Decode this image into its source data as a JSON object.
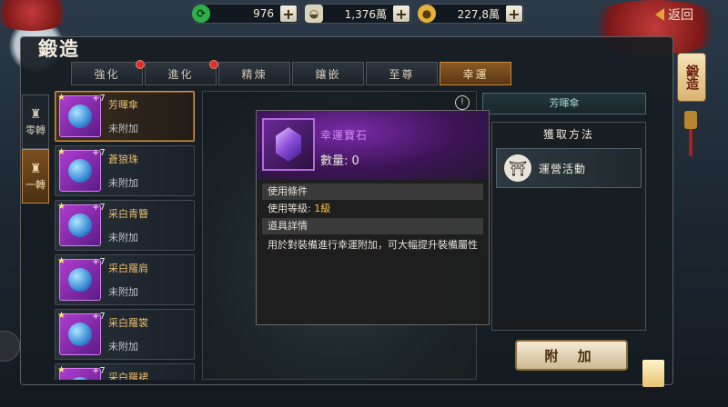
{
  "resources": [
    {
      "icon": "jade-token-icon",
      "value": "976",
      "color": "#2fae4a"
    },
    {
      "icon": "silver-ingot-icon",
      "value": "1,376萬",
      "color": "#d8d2b8"
    },
    {
      "icon": "gold-coin-icon",
      "value": "227,8萬",
      "color": "#e2b23a"
    }
  ],
  "back_label": "返回",
  "page_title": "鍛造",
  "tabs": [
    {
      "label": "強化",
      "badge": true,
      "active": false
    },
    {
      "label": "進化",
      "badge": true,
      "active": false
    },
    {
      "label": "精煉",
      "badge": false,
      "active": false
    },
    {
      "label": "鑲嵌",
      "badge": false,
      "active": false
    },
    {
      "label": "至尊",
      "badge": false,
      "active": false
    },
    {
      "label": "幸運",
      "badge": false,
      "active": true
    }
  ],
  "side_tabs": [
    {
      "label": "零轉",
      "active": false
    },
    {
      "label": "一轉",
      "active": true
    }
  ],
  "items": [
    {
      "name": "芳暉傘",
      "level": "+7",
      "status": "未附加",
      "selected": true
    },
    {
      "name": "蒼狼珠",
      "level": "+7",
      "status": "未附加",
      "selected": false
    },
    {
      "name": "采白青簪",
      "level": "+7",
      "status": "未附加",
      "selected": false
    },
    {
      "name": "采白羅肩",
      "level": "+7",
      "status": "未附加",
      "selected": false
    },
    {
      "name": "采白羅裳",
      "level": "+7",
      "status": "未附加",
      "selected": false
    },
    {
      "name": "采白羅裙",
      "level": "+7",
      "status": "",
      "selected": false
    }
  ],
  "tooltip": {
    "item_name": "幸運寶石",
    "quantity_label": "數量: 0",
    "use_condition_title": "使用條件",
    "use_level_label": "使用等級:",
    "use_level_value": "1級",
    "detail_title": "道具詳情",
    "description": "用於對裝備進行幸運附加，可大幅提升裝備屬性"
  },
  "right": {
    "selected_item": "芳暉傘",
    "acquire_title": "獲取方法",
    "source_label": "運營活動"
  },
  "attach_button": "附 加",
  "side_badge": "鍛造"
}
